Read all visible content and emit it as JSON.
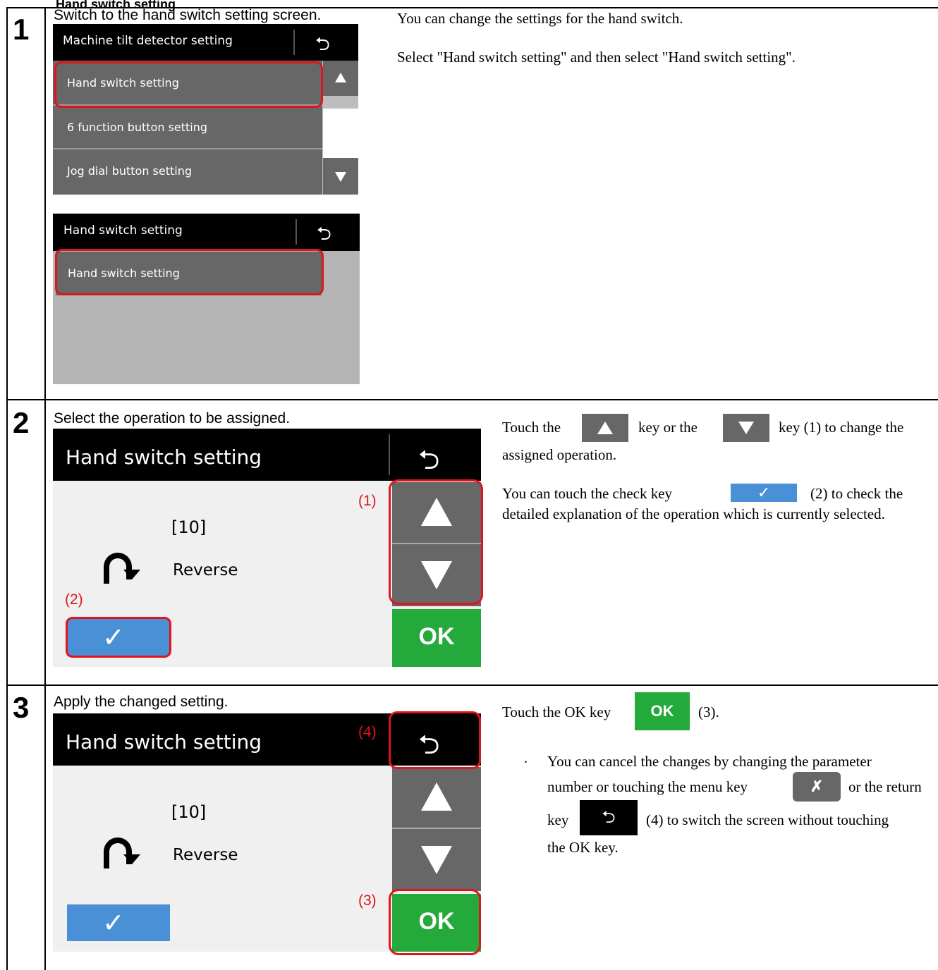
{
  "section_title": "Hand switch setting",
  "steps": [
    {
      "number": "1",
      "caption": "Switch to the hand switch setting screen.",
      "desc1": "You can change the settings for the hand switch.",
      "desc2": "Select \"Hand switch setting\" and then select \"Hand switch setting\".",
      "screenA": {
        "title": "Machine tilt detector setting",
        "items": [
          "Hand switch setting",
          "6 function button setting",
          "Jog dial button setting"
        ]
      },
      "screenB": {
        "title": "Hand switch setting",
        "items": [
          "Hand switch setting"
        ]
      }
    },
    {
      "number": "2",
      "caption": "Select the operation to be assigned.",
      "screen_title": "Hand switch setting",
      "param": "[10]",
      "operation": "Reverse",
      "ok_label": "OK",
      "marker1": "(1)",
      "marker2": "(2)",
      "d_touch": "Touch the",
      "d_key_or_the": "key or the",
      "d_key1": "key (1) to change the",
      "d_assigned": "assigned operation.",
      "d_check_a": "You can touch the check key",
      "d_check_b": "(2) to check the",
      "d_check_c": "detailed explanation of the operation which is currently selected."
    },
    {
      "number": "3",
      "caption": "Apply the changed setting.",
      "screen_title": "Hand switch setting",
      "param": "[10]",
      "operation": "Reverse",
      "ok_label": "OK",
      "marker3": "(3)",
      "marker4": "(4)",
      "d_touch_ok": "Touch the OK key",
      "d_three": "(3).",
      "bullet": "·",
      "d_cancel_a": "You can cancel the changes by changing the parameter",
      "d_cancel_b": "number or touching the menu key",
      "d_cancel_c": "or the return",
      "d_cancel_d": "key",
      "d_cancel_e": "(4) to switch the screen without touching",
      "d_cancel_f": "the OK key."
    }
  ],
  "colors": {
    "red": "#e0141c",
    "ok_green": "#24a93b",
    "check_blue": "#4a90d6",
    "key_gray": "#676767"
  }
}
